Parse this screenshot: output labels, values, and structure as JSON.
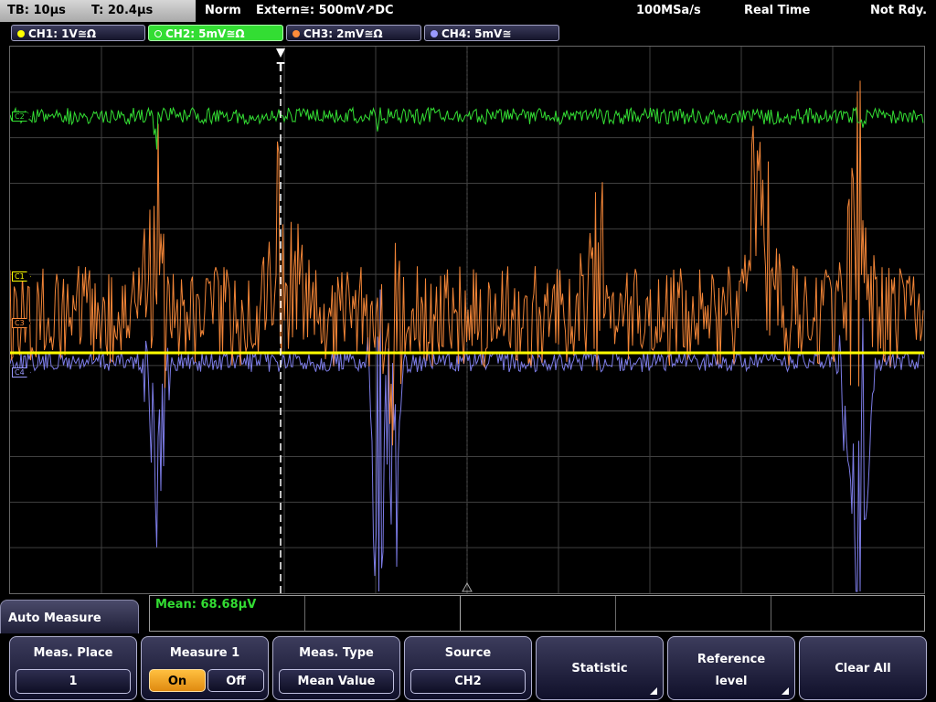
{
  "status_bar": {
    "timebase": "TB: 10µs",
    "trigger_time": "T: 20.4µs",
    "trigger_mode": "Norm",
    "trigger_source": "Extern≅: 500mV↗DC",
    "sample_rate": "100MSa/s",
    "acq_mode": "Real Time",
    "status": "Not Rdy."
  },
  "channels": [
    {
      "label": "CH1: 1V≅Ω",
      "color": "#ffff00",
      "active": false
    },
    {
      "label": "CH2: 5mV≅Ω",
      "color": "#33dd33",
      "active": true
    },
    {
      "label": "CH3: 2mV≅Ω",
      "color": "#ff8c3a",
      "active": false
    },
    {
      "label": "CH4: 5mV≅",
      "color": "#9a9aff",
      "active": false
    }
  ],
  "markers": {
    "c2": "C2",
    "c1": "C1",
    "c3": "C3",
    "c4": "C4",
    "trigger": "T"
  },
  "measurement": {
    "mean_text": "Mean: 68.68µV"
  },
  "menu_title": "Auto Measure",
  "softkeys": {
    "meas_place": {
      "title": "Meas. Place",
      "value": "1"
    },
    "measure1": {
      "title": "Measure 1",
      "on": "On",
      "off": "Off"
    },
    "meas_type": {
      "title": "Meas. Type",
      "value": "Mean Value"
    },
    "source": {
      "title": "Source",
      "value": "CH2"
    },
    "statistic": {
      "title": "Statistic"
    },
    "reference_level": {
      "title_line1": "Reference",
      "title_line2": "level"
    },
    "clear_all": {
      "title": "Clear All"
    }
  },
  "colors": {
    "ch1": "#ffff00",
    "ch2": "#33dd33",
    "ch3": "#ff8c3a",
    "ch4": "#8a8aff",
    "grid": "#404040"
  }
}
